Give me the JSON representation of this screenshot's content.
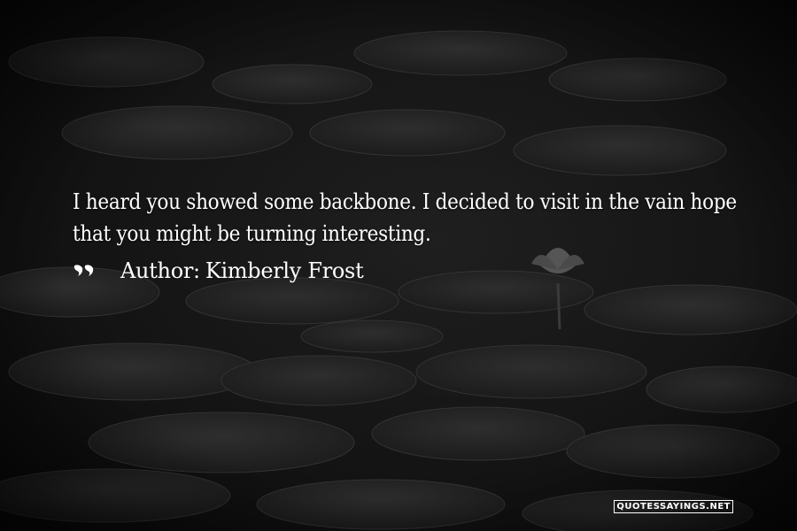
{
  "quote": {
    "line1": "I heard you showed some backbone. I decided to visit in the vain hope",
    "line2": "that you might be turning interesting.",
    "author_prefix": "Author:",
    "author": "Kimberly Frost",
    "icon": "quotation-marks-icon"
  },
  "watermark": "QUOTESSAYINGS.NET",
  "colors": {
    "background": "#141414",
    "text": "#ffffff",
    "lily_pad": "#262626",
    "lily_pad_edge": "#333333"
  }
}
